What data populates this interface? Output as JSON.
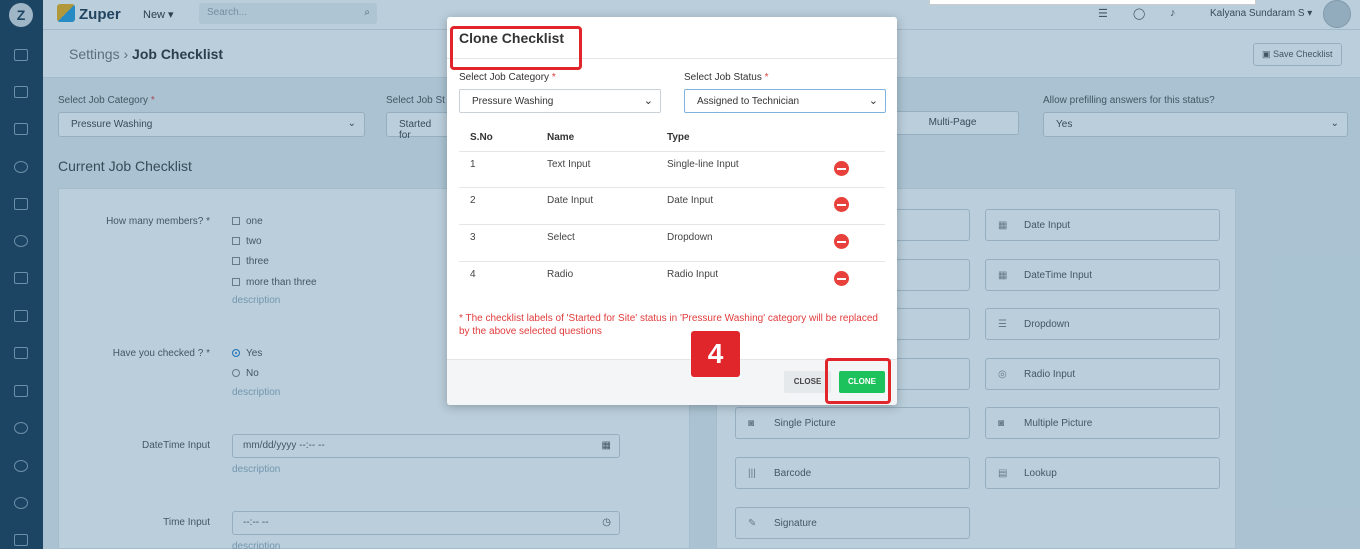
{
  "topbar": {
    "brand": "Zuper",
    "new_label": "New ▾",
    "search_placeholder": "Search...",
    "user_name": "Kalyana Sundaram S ▾"
  },
  "header": {
    "crumb_settings": "Settings",
    "crumb_separator": "›",
    "crumb_page": "Job Checklist",
    "save_label": "Save Checklist"
  },
  "filters": {
    "category_label": "Select Job Category",
    "category_value": "Pressure Washing",
    "status_label": "Select Job St",
    "status_value": "Started for",
    "multipage_label": "Multi-Page",
    "prefill_label": "Allow prefilling answers for this status?",
    "prefill_value": "Yes"
  },
  "checklist": {
    "title": "Current Job Checklist",
    "q1_label": "How many members? *",
    "q1_options": [
      "one",
      "two",
      "three",
      "more than three"
    ],
    "q1_desc": "description",
    "q2_label": "Have you checked ? *",
    "q2_options": [
      "Yes",
      "No"
    ],
    "q2_desc": "description",
    "q3_label": "DateTime Input",
    "q3_placeholder": "mm/dd/yyyy --:-- --",
    "q3_desc": "description",
    "q4_label": "Time Input",
    "q4_placeholder": "--:-- --",
    "q4_desc": "description"
  },
  "field_types": {
    "left": [
      "Single Picture",
      "Barcode",
      "Signature"
    ],
    "right": [
      "Date Input",
      "DateTime Input",
      "Dropdown",
      "Radio Input",
      "Multiple Picture",
      "Lookup"
    ]
  },
  "modal": {
    "title": "Clone Checklist",
    "category_label": "Select Job Category",
    "category_value": "Pressure Washing",
    "status_label": "Select Job Status",
    "status_value": "Assigned to Technician",
    "required_mark": "*",
    "columns": {
      "sno": "S.No",
      "name": "Name",
      "type": "Type"
    },
    "rows": [
      {
        "sno": "1",
        "name": "Text Input",
        "type": "Single-line Input"
      },
      {
        "sno": "2",
        "name": "Date Input",
        "type": "Date Input"
      },
      {
        "sno": "3",
        "name": "Select",
        "type": "Dropdown"
      },
      {
        "sno": "4",
        "name": "Radio",
        "type": "Radio Input"
      }
    ],
    "warning": "* The checklist labels of 'Started for Site' status in 'Pressure Washing' category will be replaced by the above selected questions",
    "close_label": "CLOSE",
    "clone_label": "CLONE"
  },
  "annotation": {
    "step_number": "4",
    "highlight_color": "#e0252b"
  },
  "colors": {
    "sidebar": "#1d3b53",
    "clone_green": "#1ec25d",
    "remove_red": "#e8403a",
    "warning_red": "#e23b3b"
  }
}
